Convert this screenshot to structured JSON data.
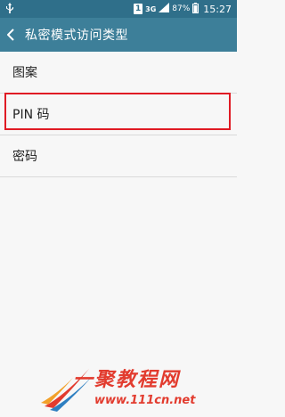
{
  "status_bar": {
    "usb_icon": "usb-icon",
    "sim_badge": "1",
    "network_type": "3G",
    "battery_percent": "87%",
    "time": "15:27"
  },
  "action_bar": {
    "title": "私密模式访问类型",
    "back_icon": "chevron-left-icon"
  },
  "options": [
    {
      "label": "图案"
    },
    {
      "label": "PIN 码"
    },
    {
      "label": "密码"
    }
  ],
  "highlighted_option_index": 1,
  "highlight_color": "#e01b24",
  "watermark": {
    "main": "一聚教程网",
    "url": "www.111cn.net"
  }
}
